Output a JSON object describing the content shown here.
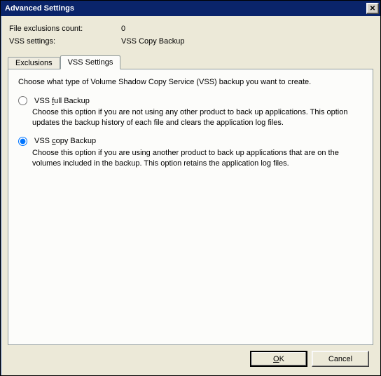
{
  "window": {
    "title": "Advanced Settings"
  },
  "info": {
    "exclusions_label": "File exclusions count:",
    "exclusions_value": "0",
    "vss_label": "VSS settings:",
    "vss_value": "VSS Copy Backup"
  },
  "tabs": {
    "exclusions": "Exclusions",
    "vss_settings": "VSS Settings",
    "active": "vss_settings"
  },
  "panel": {
    "intro": "Choose what type of Volume Shadow Copy Service (VSS) backup you want to create.",
    "options": {
      "full": {
        "label_pre": "VSS ",
        "label_key": "f",
        "label_post": "ull Backup",
        "desc": "Choose this option if you are not using any other product to back up applications. This option updates the backup history of each file and clears the application log files.",
        "selected": false
      },
      "copy": {
        "label_pre": "VSS ",
        "label_key": "c",
        "label_post": "opy Backup",
        "desc": "Choose this option if you are using another product to back up applications that are on the volumes included in the backup. This option retains the application log files.",
        "selected": true
      }
    }
  },
  "buttons": {
    "ok_key": "O",
    "ok_post": "K",
    "cancel": "Cancel"
  }
}
